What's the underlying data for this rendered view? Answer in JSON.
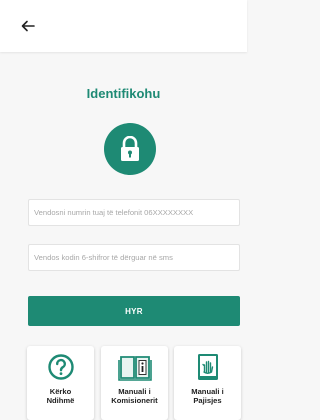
{
  "header": {
    "back_icon": "arrow-left-icon"
  },
  "page": {
    "title": "Identifikohu",
    "lock_icon": "padlock-icon"
  },
  "form": {
    "phone_placeholder": "Vendosni numrin tuaj të telefonit 06XXXXXXXX",
    "code_placeholder": "Vendos kodin 6-shifror të dërguar në sms",
    "submit_label": "HYR"
  },
  "cards": [
    {
      "line1": "Kërko",
      "line2": "Ndihmë",
      "icon": "question-circle-icon"
    },
    {
      "line1": "Manuali i",
      "line2": "Komisionerit",
      "icon": "info-book-icon"
    },
    {
      "line1": "Manuali i",
      "line2": "Pajisjes",
      "icon": "hand-book-icon"
    }
  ],
  "colors": {
    "accent": "#1e8a74",
    "background": "#f7f7f7"
  }
}
